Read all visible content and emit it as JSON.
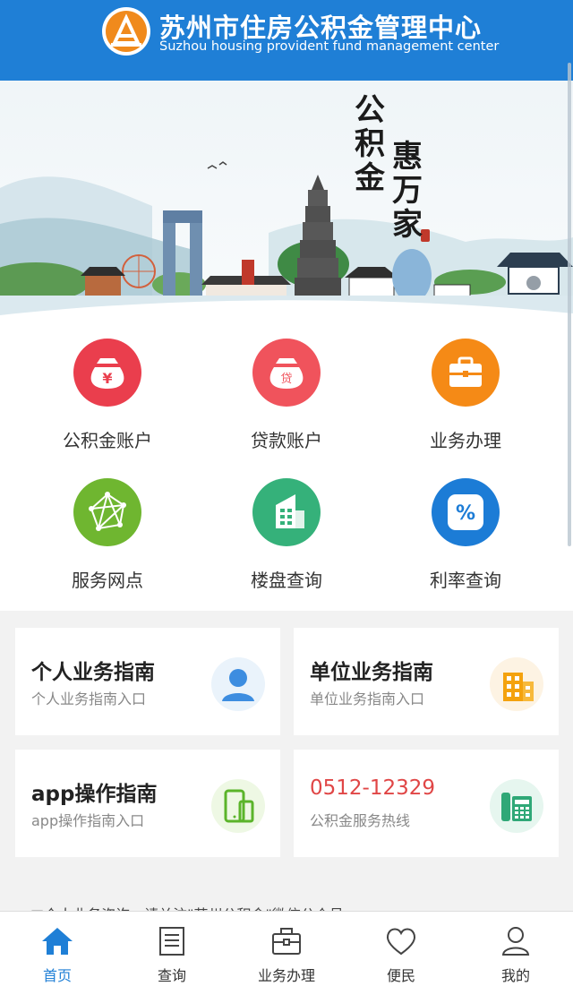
{
  "header": {
    "title_cn": "苏州市住房公积金管理中心",
    "title_en": "Suzhou housing provident fund management center",
    "logo_icon": "provident-fund-logo-icon"
  },
  "banner": {
    "slogan_line1": "公积金",
    "slogan_line2": "惠万家"
  },
  "grid": [
    {
      "label": "公积金账户",
      "icon": "yuan-bag-icon",
      "color": "#ea3e4d"
    },
    {
      "label": "贷款账户",
      "icon": "loan-bag-icon",
      "color": "#f0535c"
    },
    {
      "label": "业务办理",
      "icon": "briefcase-icon",
      "color": "#f58a16"
    },
    {
      "label": "服务网点",
      "icon": "network-icon",
      "color": "#6fb630"
    },
    {
      "label": "楼盘查询",
      "icon": "building-icon",
      "color": "#35b17a"
    },
    {
      "label": "利率查询",
      "icon": "percent-icon",
      "color": "#1c7cd6"
    }
  ],
  "cards": [
    {
      "title": "个人业务指南",
      "sub": "个人业务指南入口",
      "icon": "person-icon"
    },
    {
      "title": "单位业务指南",
      "sub": "单位业务指南入口",
      "icon": "office-building-icon"
    },
    {
      "title": "app操作指南",
      "sub": "app操作指南入口",
      "icon": "mobile-phone-icon"
    },
    {
      "title": "0512-12329",
      "sub": "公积金服务热线",
      "icon": "telephone-icon"
    }
  ],
  "ticker": {
    "text": "■个人业务咨询，请关注\"苏州公积金\"微信公众号..."
  },
  "tabbar": [
    {
      "label": "首页",
      "icon": "home-icon",
      "active": true
    },
    {
      "label": "查询",
      "icon": "document-icon",
      "active": false
    },
    {
      "label": "业务办理",
      "icon": "briefcase-outline-icon",
      "active": false
    },
    {
      "label": "便民",
      "icon": "heart-icon",
      "active": false
    },
    {
      "label": "我的",
      "icon": "user-icon",
      "active": false
    }
  ],
  "colors": {
    "brand_blue": "#1f7fd6",
    "logo_orange": "#f08a1c",
    "hotline_red": "#e04646"
  }
}
